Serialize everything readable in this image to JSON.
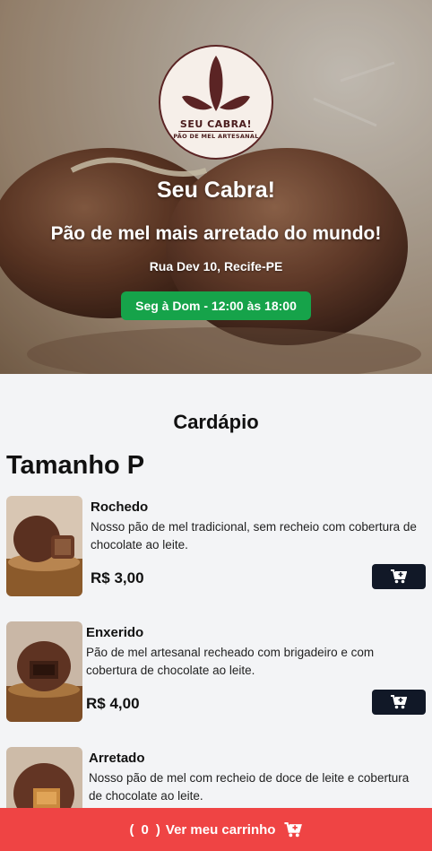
{
  "hero": {
    "logo": {
      "name": "SEU CABRA!",
      "subtitle": "PÃO DE MEL ARTESANAL"
    },
    "title": "Seu Cabra!",
    "tagline": "Pão de mel mais arretado do mundo!",
    "address": "Rua Dev 10, Recife-PE",
    "hours": "Seg à Dom - 12:00 às 18:00"
  },
  "menu": {
    "title": "Cardápio",
    "section_title": "Tamanho P",
    "items": [
      {
        "name": "Rochedo",
        "description": "Nosso pão de mel tradicional, sem recheio com cobertura de chocolate ao leite.",
        "price": "R$ 3,00",
        "image": "pao-de-mel-rochedo"
      },
      {
        "name": "Enxerido",
        "description": "Pão de mel artesanal recheado com brigadeiro e com cobertura de chocolate ao leite.",
        "price": "R$ 4,00",
        "image": "pao-de-mel-enxerido"
      },
      {
        "name": "Arretado",
        "description": "Nosso pão de mel com recheio de doce de leite e cobertura de chocolate ao leite.",
        "price": "",
        "image": "pao-de-mel-arretado"
      }
    ]
  },
  "cart_bar": {
    "open_paren": "(",
    "count": "0",
    "close_paren": ")",
    "label": "Ver meu carrinho"
  },
  "colors": {
    "hours_badge": "#16a34a",
    "cart_button": "#111827",
    "cart_bar": "#ef4444",
    "brand_brown": "#4a1c1c"
  },
  "icons": {
    "add_to_cart": "cart-plus-icon",
    "cart": "cart-icon"
  }
}
